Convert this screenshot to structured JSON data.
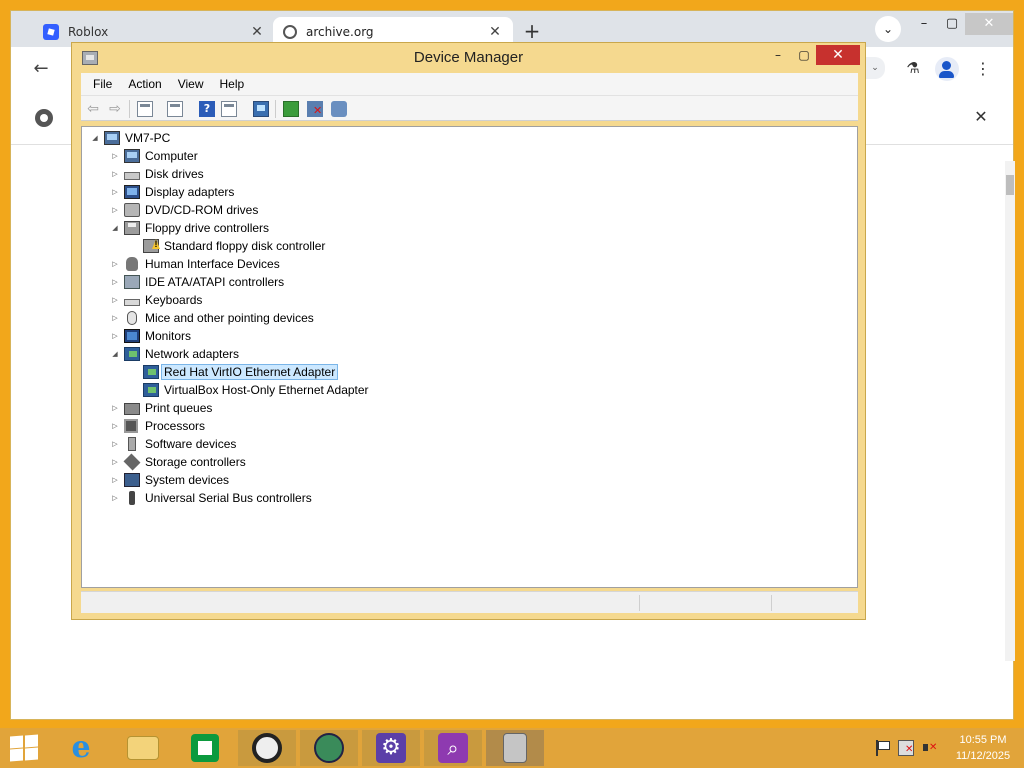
{
  "browser": {
    "tabs": [
      {
        "label": "Roblox",
        "icon": "roblox-icon"
      },
      {
        "label": "archive.org",
        "icon": "globe-icon"
      }
    ],
    "new_tab_symbol": "+",
    "tab_close_symbol": "✕",
    "search_tabs_symbol": "⌄",
    "window_controls": {
      "minimize": "–",
      "maximize": "▢",
      "close": "✕"
    },
    "back_symbol": "←",
    "omnibox_dropdown_symbol": "⌄",
    "labs_symbol": "⚗",
    "menu_symbol": "⋮",
    "infobar_close_symbol": "✕"
  },
  "device_manager": {
    "title": "Device Manager",
    "window_controls": {
      "minimize": "–",
      "maximize": "▢",
      "close": "✕"
    },
    "menu": [
      "File",
      "Action",
      "View",
      "Help"
    ],
    "toolbar": {
      "back": "⇦",
      "forward": "⇨",
      "help": "?"
    },
    "tree": {
      "root": "VM7-PC",
      "collapsed_symbol": "▷",
      "expanded_symbol": "◢",
      "categories": [
        {
          "label": "Computer",
          "icon": "computer-icon",
          "expanded": false
        },
        {
          "label": "Disk drives",
          "icon": "disk-drive-icon",
          "expanded": false
        },
        {
          "label": "Display adapters",
          "icon": "display-adapter-icon",
          "expanded": false
        },
        {
          "label": "DVD/CD-ROM drives",
          "icon": "dvd-icon",
          "expanded": false
        },
        {
          "label": "Floppy drive controllers",
          "icon": "floppy-controller-icon",
          "expanded": true,
          "children": [
            {
              "label": "Standard floppy disk controller",
              "icon": "floppy-warning-icon"
            }
          ]
        },
        {
          "label": "Human Interface Devices",
          "icon": "hid-icon",
          "expanded": false
        },
        {
          "label": "IDE ATA/ATAPI controllers",
          "icon": "ide-icon",
          "expanded": false
        },
        {
          "label": "Keyboards",
          "icon": "keyboard-icon",
          "expanded": false
        },
        {
          "label": "Mice and other pointing devices",
          "icon": "mouse-icon",
          "expanded": false
        },
        {
          "label": "Monitors",
          "icon": "monitor-icon",
          "expanded": false
        },
        {
          "label": "Network adapters",
          "icon": "network-adapter-icon",
          "expanded": true,
          "children": [
            {
              "label": "Red Hat VirtIO Ethernet Adapter",
              "icon": "network-adapter-icon",
              "selected": true
            },
            {
              "label": "VirtualBox Host-Only Ethernet Adapter",
              "icon": "network-adapter-icon"
            }
          ]
        },
        {
          "label": "Print queues",
          "icon": "printer-icon",
          "expanded": false
        },
        {
          "label": "Processors",
          "icon": "processor-icon",
          "expanded": false
        },
        {
          "label": "Software devices",
          "icon": "software-device-icon",
          "expanded": false
        },
        {
          "label": "Storage controllers",
          "icon": "storage-controller-icon",
          "expanded": false
        },
        {
          "label": "System devices",
          "icon": "system-device-icon",
          "expanded": false
        },
        {
          "label": "Universal Serial Bus controllers",
          "icon": "usb-icon",
          "expanded": false
        }
      ]
    }
  },
  "taskbar": {
    "items": [
      {
        "name": "internet-explorer",
        "icon": "internet-explorer-icon",
        "glyph": "e"
      },
      {
        "name": "file-explorer",
        "icon": "folder-icon"
      },
      {
        "name": "store",
        "icon": "store-icon"
      },
      {
        "name": "webcam",
        "icon": "webcam-icon"
      },
      {
        "name": "browser",
        "icon": "globe-icon"
      },
      {
        "name": "settings",
        "icon": "gear-icon",
        "glyph": "⚙"
      },
      {
        "name": "search",
        "icon": "search-icon",
        "glyph": "⌕"
      },
      {
        "name": "device-manager",
        "icon": "device-manager-icon",
        "active": true
      }
    ],
    "clock": {
      "time": "10:55 PM",
      "date": "11/12/2025"
    }
  }
}
